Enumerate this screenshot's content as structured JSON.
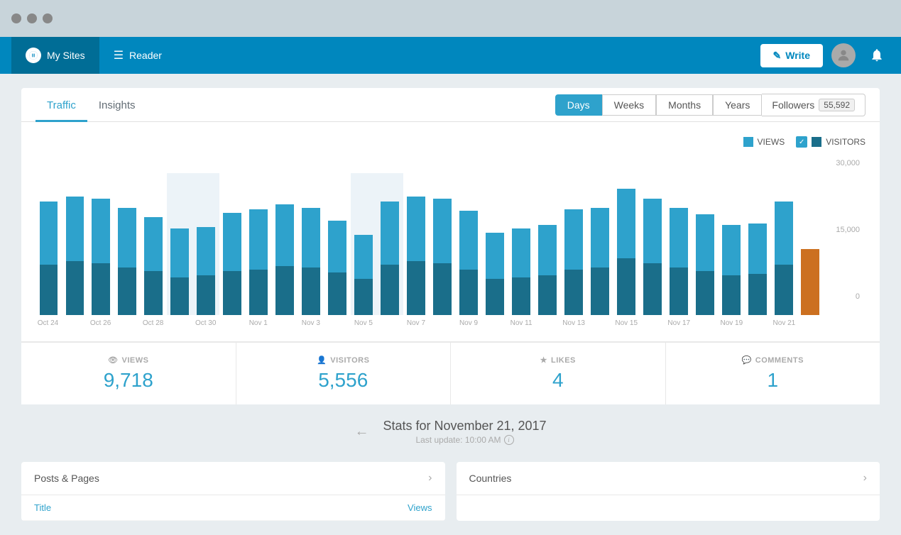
{
  "titlebar": {
    "dots": [
      "dot1",
      "dot2",
      "dot3"
    ]
  },
  "navbar": {
    "mysites_label": "My Sites",
    "reader_label": "Reader",
    "write_label": "Write"
  },
  "tabs": {
    "traffic_label": "Traffic",
    "insights_label": "Insights"
  },
  "periods": {
    "days_label": "Days",
    "weeks_label": "Weeks",
    "months_label": "Months",
    "years_label": "Years",
    "followers_label": "Followers",
    "followers_count": "55,592"
  },
  "chart": {
    "legend_views": "VIEWS",
    "legend_visitors": "VISITORS",
    "y_max": "30,000",
    "y_mid": "15,000",
    "y_min": "0",
    "bars": [
      {
        "label": "Oct 24",
        "views": 72,
        "visitors": 32,
        "highlight": false,
        "active": false
      },
      {
        "label": "",
        "views": 75,
        "visitors": 34,
        "highlight": false,
        "active": false
      },
      {
        "label": "Oct 26",
        "views": 74,
        "visitors": 33,
        "highlight": false,
        "active": false
      },
      {
        "label": "",
        "views": 68,
        "visitors": 30,
        "highlight": false,
        "active": false
      },
      {
        "label": "Oct 28",
        "views": 62,
        "visitors": 28,
        "highlight": false,
        "active": false
      },
      {
        "label": "",
        "views": 55,
        "visitors": 24,
        "highlight": true,
        "active": false
      },
      {
        "label": "Oct 30",
        "views": 56,
        "visitors": 25,
        "highlight": true,
        "active": false
      },
      {
        "label": "",
        "views": 65,
        "visitors": 28,
        "highlight": false,
        "active": false
      },
      {
        "label": "Nov 1",
        "views": 67,
        "visitors": 29,
        "highlight": false,
        "active": false
      },
      {
        "label": "",
        "views": 70,
        "visitors": 31,
        "highlight": false,
        "active": false
      },
      {
        "label": "Nov 3",
        "views": 68,
        "visitors": 30,
        "highlight": false,
        "active": false
      },
      {
        "label": "",
        "views": 60,
        "visitors": 27,
        "highlight": false,
        "active": false
      },
      {
        "label": "Nov 5",
        "views": 51,
        "visitors": 23,
        "highlight": true,
        "active": false
      },
      {
        "label": "",
        "views": 72,
        "visitors": 32,
        "highlight": true,
        "active": false
      },
      {
        "label": "Nov 7",
        "views": 75,
        "visitors": 34,
        "highlight": false,
        "active": false
      },
      {
        "label": "",
        "views": 74,
        "visitors": 33,
        "highlight": false,
        "active": false
      },
      {
        "label": "Nov 9",
        "views": 66,
        "visitors": 29,
        "highlight": false,
        "active": false
      },
      {
        "label": "",
        "views": 52,
        "visitors": 23,
        "highlight": false,
        "active": false
      },
      {
        "label": "Nov 11",
        "views": 55,
        "visitors": 24,
        "highlight": false,
        "active": false
      },
      {
        "label": "",
        "views": 57,
        "visitors": 25,
        "highlight": false,
        "active": false
      },
      {
        "label": "Nov 13",
        "views": 67,
        "visitors": 29,
        "highlight": false,
        "active": false
      },
      {
        "label": "",
        "views": 68,
        "visitors": 30,
        "highlight": false,
        "active": false
      },
      {
        "label": "Nov 15",
        "views": 80,
        "visitors": 36,
        "highlight": false,
        "active": false
      },
      {
        "label": "",
        "views": 74,
        "visitors": 33,
        "highlight": false,
        "active": false
      },
      {
        "label": "Nov 17",
        "views": 68,
        "visitors": 30,
        "highlight": false,
        "active": false
      },
      {
        "label": "",
        "views": 64,
        "visitors": 28,
        "highlight": false,
        "active": false
      },
      {
        "label": "Nov 19",
        "views": 57,
        "visitors": 25,
        "highlight": false,
        "active": false
      },
      {
        "label": "",
        "views": 58,
        "visitors": 26,
        "highlight": false,
        "active": false
      },
      {
        "label": "Nov 21",
        "views": 72,
        "visitors": 32,
        "highlight": false,
        "active": false
      },
      {
        "label": "",
        "views": 38,
        "visitors": 42,
        "highlight": false,
        "active": true
      }
    ]
  },
  "stats": {
    "views_label": "VIEWS",
    "views_value": "9,718",
    "visitors_label": "VISITORS",
    "visitors_value": "5,556",
    "likes_label": "LIKES",
    "likes_value": "4",
    "comments_label": "COMMENTS",
    "comments_value": "1"
  },
  "date_section": {
    "title": "Stats for November 21, 2017",
    "subtitle": "Last update: 10:00 AM"
  },
  "posts_panel": {
    "title": "Posts & Pages",
    "col_title": "Title",
    "col_views": "Views"
  },
  "countries_panel": {
    "title": "Countries"
  }
}
